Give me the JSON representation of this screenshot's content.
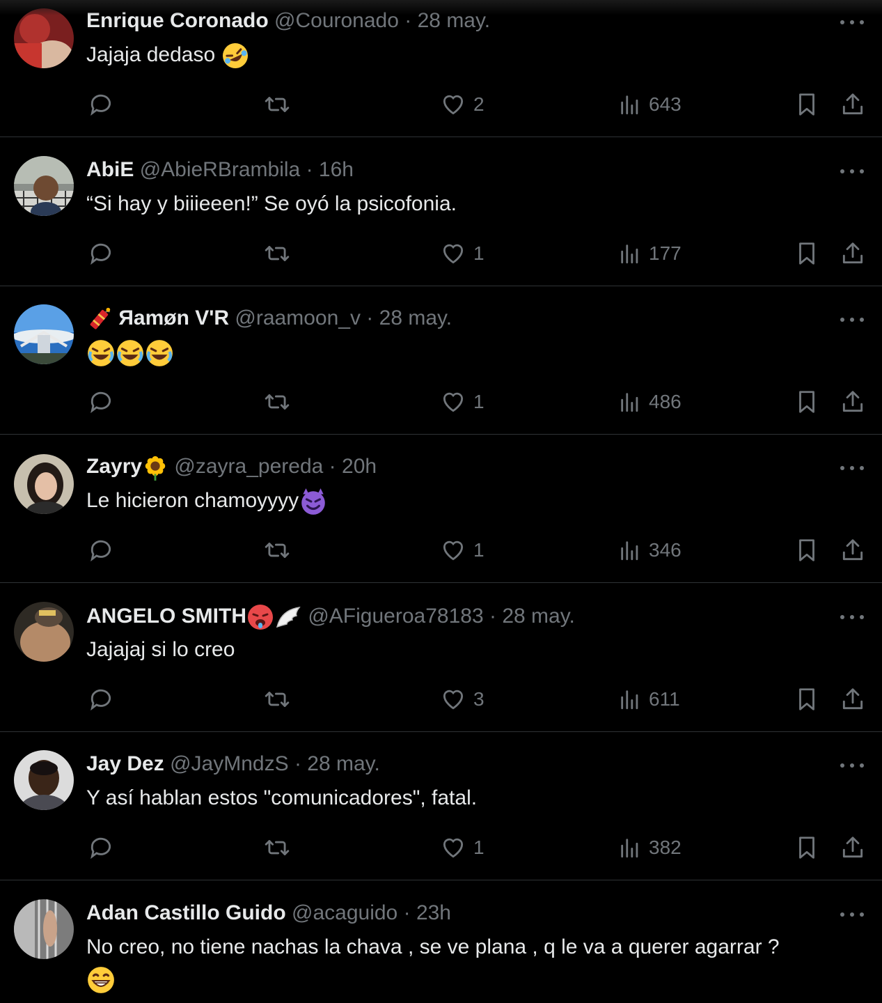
{
  "replies": [
    {
      "name": "Enrique Coronado",
      "handle": "@Couronado",
      "time": "28 may.",
      "text": "Jajaja dedaso",
      "emoji": "rolling-laughing",
      "likes": "2",
      "views": "643"
    },
    {
      "name": "AbiE",
      "handle": "@AbieRBrambila",
      "time": "16h",
      "text": "“Si hay y biiieeen!” Se oyó la psicofonia.",
      "likes": "1",
      "views": "177"
    },
    {
      "name": "Яamøn V'R",
      "handle": "@raamoon_v",
      "time": "28 may.",
      "text": "",
      "name_emoji": "firecracker",
      "emoji": "crying-laughing-x3",
      "likes": "1",
      "views": "486"
    },
    {
      "name": "Zayry",
      "handle": "@zayra_pereda",
      "time": "20h",
      "text": "Le hicieron chamoyyyy",
      "name_emoji": "sunflower",
      "emoji": "smiling-devil",
      "likes": "1",
      "views": "346"
    },
    {
      "name": "ANGELO SMITH",
      "handle": "@AFigueroa78183",
      "time": "28 may.",
      "text": "Jajajaj si lo creo",
      "name_emoji": "hot-face-wing",
      "likes": "3",
      "views": "611"
    },
    {
      "name": "Jay Dez",
      "handle": "@JayMndzS",
      "time": "28 may.",
      "text": "Y así hablan estos \"comunicadores\", fatal.",
      "likes": "1",
      "views": "382"
    },
    {
      "name": "Adan Castillo Guido",
      "handle": "@acaguido",
      "time": "23h",
      "text": "No creo, no tiene nachas la chava , se ve plana , q le va a querer agarrar ?",
      "emoji": "grinning",
      "likes": "",
      "views": ""
    }
  ],
  "separator": "·",
  "colors": {
    "background": "#000000",
    "text": "#e7e9ea",
    "muted": "#71767b",
    "border": "#2f3336"
  },
  "icons": [
    "more-icon",
    "reply-icon",
    "repost-icon",
    "like-icon",
    "views-icon",
    "bookmark-icon",
    "share-icon"
  ]
}
